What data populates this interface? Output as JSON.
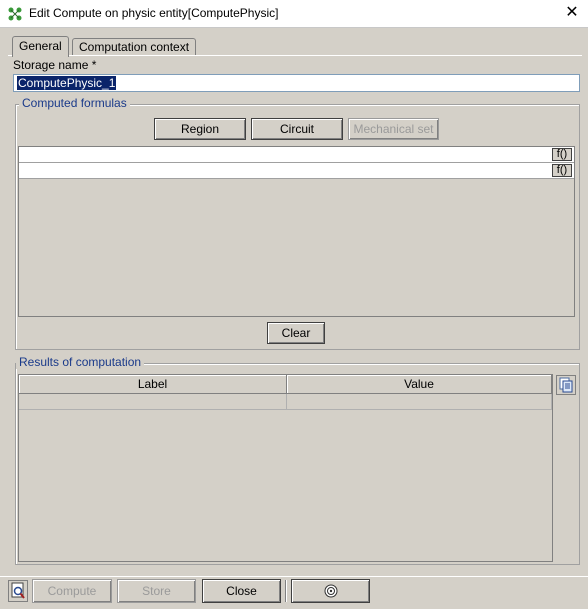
{
  "window": {
    "title": "Edit Compute on physic entity[ComputePhysic]",
    "close_glyph": "✕",
    "app_icon": "green-nodes-icon"
  },
  "tabs": [
    {
      "label": "General",
      "active": true
    },
    {
      "label": "Computation context",
      "active": false
    }
  ],
  "storage": {
    "label": "Storage name *",
    "value": "ComputePhysic_1"
  },
  "formulas": {
    "title": "Computed formulas",
    "buttons": {
      "region": "Region",
      "circuit": "Circuit",
      "mechanical_set": "Mechanical set"
    },
    "row_button": "f()",
    "clear": "Clear"
  },
  "results": {
    "title": "Results of computation",
    "columns": [
      "Label",
      "Value"
    ]
  },
  "footer": {
    "compute": "Compute",
    "store": "Store",
    "close": "Close",
    "help_icon": "help-circle-icon"
  },
  "colors": {
    "background": "#d4d0c8",
    "group_title": "#1a3a8a",
    "selection": "#0a246a"
  }
}
